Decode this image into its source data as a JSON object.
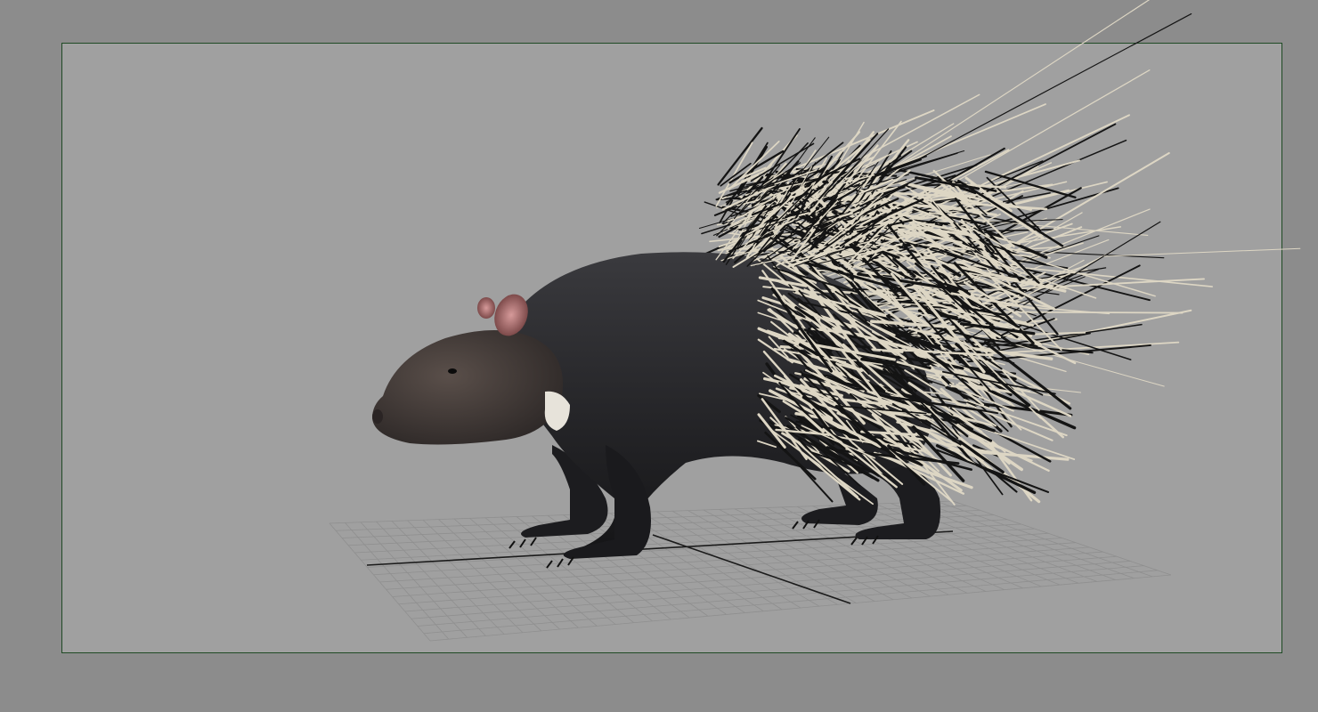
{
  "viewport": {
    "background_color": "#a0a0a0",
    "outer_background_color": "#8c8c8c",
    "resolution_gate_color": "#1f4a24"
  },
  "scene": {
    "subject_icon": "porcupine-model-icon",
    "ground_grid_visible": true,
    "grid_line_color": "#8f8f8f",
    "grid_axis_color": "#1a1a1a",
    "body_color": "#2b2b2e",
    "quill_color": "#d8d2c0"
  }
}
